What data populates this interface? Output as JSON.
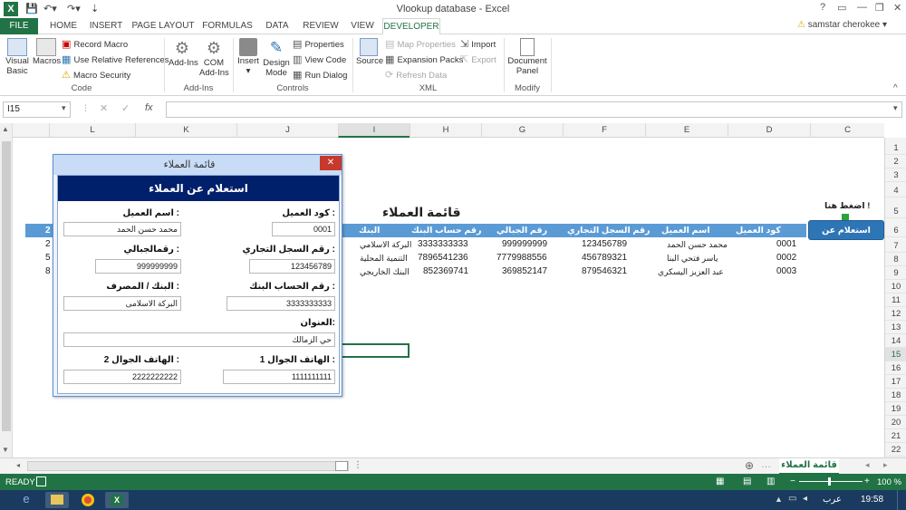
{
  "app": {
    "window_title": "Vlookup database - Excel",
    "logo": "X",
    "user": "samstar cherokee",
    "help": "?"
  },
  "tabs": [
    "FILE",
    "HOME",
    "INSERT",
    "PAGE LAYOUT",
    "FORMULAS",
    "DATA",
    "REVIEW",
    "VIEW",
    "DEVELOPER"
  ],
  "ribbon": {
    "code": {
      "name": "Code",
      "visual_basic": [
        "Visual",
        "Basic"
      ],
      "macros": "Macros",
      "record_macro": "Record Macro",
      "relative_refs": "Use Relative References",
      "macro_security": "Macro Security"
    },
    "addins": {
      "name": "Add-Ins",
      "addins": "Add-Ins",
      "com_addins": [
        "COM",
        "Add-Ins"
      ]
    },
    "controls": {
      "name": "Controls",
      "insert": "Insert",
      "design_mode": [
        "Design",
        "Mode"
      ],
      "properties": "Properties",
      "view_code": "View Code",
      "run_dialog": "Run Dialog"
    },
    "xml": {
      "name": "XML",
      "source": "Source",
      "map_properties": "Map Properties",
      "expansion_packs": "Expansion Packs",
      "refresh_data": "Refresh Data",
      "import": "Import",
      "export": "Export"
    },
    "modify": {
      "name": "Modify",
      "document_panel": [
        "Document",
        "Panel"
      ]
    }
  },
  "formula_bar": {
    "name_box": "I15",
    "fx": "fx",
    "value": ""
  },
  "columns": [
    "L",
    "K",
    "J",
    "I",
    "H",
    "G",
    "F",
    "E",
    "D",
    "C"
  ],
  "rows": [
    "1",
    "2",
    "3",
    "4",
    "5",
    "6",
    "7",
    "8",
    "9",
    "10",
    "11",
    "12",
    "13",
    "14",
    "15",
    "16",
    "17",
    "18",
    "19",
    "20",
    "21",
    "22"
  ],
  "sheet": {
    "press_here": "اضغط هنا !",
    "heading": "قائمة العملاء",
    "inquiry_button": "استعلام عن العملاء",
    "headers": [
      "كود العميل",
      "اسم العميل",
      "رقم السجل التجاري",
      "رقم الجبالي",
      "رقم حساب البنك",
      "البنك"
    ],
    "rows": [
      [
        "0001",
        "محمد حسن الحمد",
        "123456789",
        "999999999",
        "3333333333",
        "البركة الاسلامي"
      ],
      [
        "0002",
        "ياسر فتحي البنا",
        "456789321",
        "7779988556",
        "7896541236",
        "التنمية المحلية"
      ],
      [
        "0003",
        "عبد العزيز اليسكري",
        "879546321",
        "369852147",
        "852369741",
        "البنك الخاريجي"
      ]
    ],
    "partial_col": [
      "2",
      "2",
      "5",
      "8"
    ]
  },
  "dialog": {
    "window_title": "قائمة العملاء",
    "header": "استعلام عن العملاء",
    "close": "✕",
    "labels": {
      "code": "كود العميل :",
      "name": "اسم العميل :",
      "cr": "رقم السجل التجاري :",
      "jabali": "رقمالجبالي :",
      "account": "رقم الحساب البنك :",
      "bank": "البنك / المصرف :",
      "address": "العنوان:",
      "mobile1": "الهاتف الجوال 1 :",
      "mobile2": "الهاتف الجوال 2 :"
    },
    "values": {
      "code": "0001",
      "name": "محمد حسن الحمد",
      "cr": "123456789",
      "jabali": "999999999",
      "account": "3333333333",
      "bank": "البركة الاسلامى",
      "address": "حي الزمالك",
      "mobile1": "1111111111",
      "mobile2": "2222222222"
    }
  },
  "sheet_tab": "قائمة العملاء",
  "status": {
    "mode": "READY",
    "zoom": "100 %"
  },
  "taskbar": {
    "lang": "عرب",
    "time": "19:58"
  },
  "colors": {
    "excel_green": "#217346",
    "dialog_header": "#00206b",
    "table_header": "#5b9bd5",
    "button": "#2e75b6"
  }
}
